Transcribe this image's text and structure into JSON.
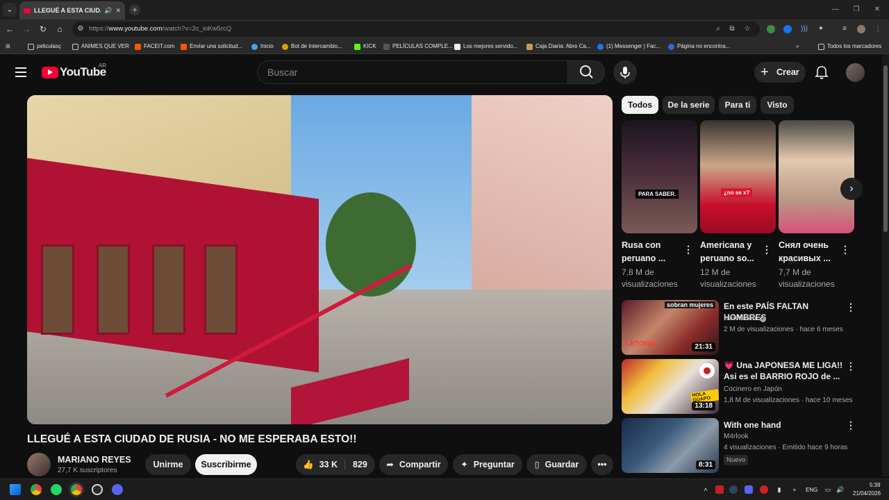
{
  "browser": {
    "tab_title": "LLEGUÉ A ESTA CIUDAD DE",
    "url_prefix": "https://",
    "url_host": "www.youtube.com",
    "url_path": "/watch?v=2c_ioKw5rcQ",
    "bookmarks": [
      "peliculasç",
      "ANIMES QUE VER",
      "FACEIT.com",
      "Enviar una solicitud...",
      "Inicio",
      "Bot de Intercambio...",
      "KICK",
      "PELÍCULAS COMPLE...",
      "Los mejores servido...",
      "Caja Diaria: Abre Ca...",
      "(1) Messenger | Fac...",
      "Página no encontra..."
    ],
    "all_bookmarks": "Todos los marcadores"
  },
  "header": {
    "logo_text": "YouTube",
    "country": "AR",
    "search_placeholder": "Buscar",
    "create_label": "Crear"
  },
  "video": {
    "title": "LLEGUÉ A ESTA CIUDAD DE RUSIA - NO ME ESPERABA ESTO!!",
    "channel": "MARIANO REYES",
    "subscribers": "27,7 K suscriptores",
    "join_label": "Unirme",
    "subscribe_label": "Suscribirme",
    "likes": "33 K",
    "comments": "829",
    "share_label": "Compartir",
    "ask_label": "Preguntar",
    "save_label": "Guardar"
  },
  "sidebar": {
    "chips": [
      "Todos",
      "De la serie",
      "Para ti",
      "Visto"
    ],
    "shorts": [
      {
        "title": "Rusa con peruano ...",
        "views": "7,8 M de visualizaciones",
        "caption": "PARA SABER."
      },
      {
        "title": "Americana y peruano so...",
        "views": "12 M de visualizaciones",
        "caption": "¿no se x?"
      },
      {
        "title": "Снял очень красивых ...",
        "views": "7,7 M de visualizaciones",
        "caption": ""
      }
    ],
    "videos": [
      {
        "title": "En este PAÍS FALTAN HOMBRES",
        "channel": "Iván Latam",
        "meta": "2 M de visualizaciones · hace 6 meses",
        "duration": "21:31",
        "thumb_text": "sobran mujeres",
        "thumb_sub": "LETONIA"
      },
      {
        "title": "💗 Una JAPONESA ME LIGA!! Asi es el BARRIO ROJO de ...",
        "channel": "Cocinero en Japón",
        "meta": "1,8 M de visualizaciones · hace 10 meses",
        "duration": "13:18",
        "thumb_text": "HOLA GUAPO"
      },
      {
        "title": "With one hand",
        "channel": "M4rlook",
        "meta": "4 visualizaciones · Emitido hace 9 horas",
        "duration": "8:31",
        "badge": "Nuevo"
      }
    ]
  },
  "taskbar": {
    "lang": "ENG",
    "time": "5:39",
    "date": "21/04/2026"
  },
  "colors": {
    "brand_red": "#ff0033",
    "bg": "#0f0f0f",
    "pill": "#272727"
  }
}
